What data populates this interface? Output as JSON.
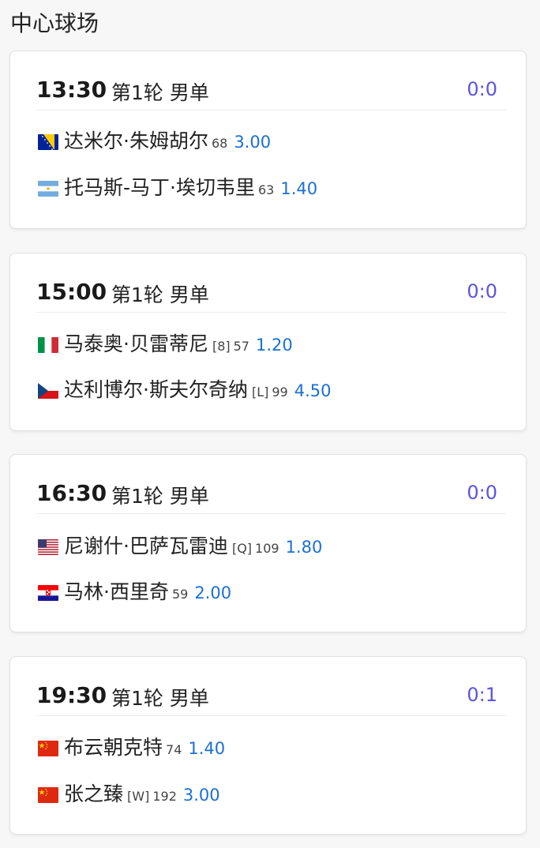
{
  "court": {
    "title": "中心球场"
  },
  "matches": [
    {
      "time": "13:30",
      "round": "第1轮 男单",
      "score": "0:0",
      "players": [
        {
          "flag": "bosnia-flag-icon",
          "name": "达米尔·朱姆胡尔",
          "seed": "",
          "rank": "68",
          "odds": "3.00"
        },
        {
          "flag": "argentina-flag-icon",
          "name": "托马斯-马丁·埃切韦里",
          "seed": "",
          "rank": "63",
          "odds": "1.40"
        }
      ]
    },
    {
      "time": "15:00",
      "round": "第1轮 男单",
      "score": "0:0",
      "players": [
        {
          "flag": "italy-flag-icon",
          "name": "马泰奥·贝雷蒂尼",
          "seed": "[8]",
          "rank": "57",
          "odds": "1.20"
        },
        {
          "flag": "czech-flag-icon",
          "name": "达利博尔·斯夫尔奇纳",
          "seed": "[L]",
          "rank": "99",
          "odds": "4.50"
        }
      ]
    },
    {
      "time": "16:30",
      "round": "第1轮 男单",
      "score": "0:0",
      "players": [
        {
          "flag": "usa-flag-icon",
          "name": "尼谢什·巴萨瓦雷迪",
          "seed": "[Q]",
          "rank": "109",
          "odds": "1.80"
        },
        {
          "flag": "croatia-flag-icon",
          "name": "马林·西里奇",
          "seed": "",
          "rank": "59",
          "odds": "2.00"
        }
      ]
    },
    {
      "time": "19:30",
      "round": "第1轮 男单",
      "score": "0:1",
      "players": [
        {
          "flag": "china-flag-icon",
          "name": "布云朝克特",
          "seed": "",
          "rank": "74",
          "odds": "1.40"
        },
        {
          "flag": "china-flag-icon",
          "name": "张之臻",
          "seed": "[W]",
          "rank": "192",
          "odds": "3.00"
        }
      ]
    }
  ],
  "colors": {
    "score": "#5b55e0",
    "odds": "#1a6fd6"
  }
}
